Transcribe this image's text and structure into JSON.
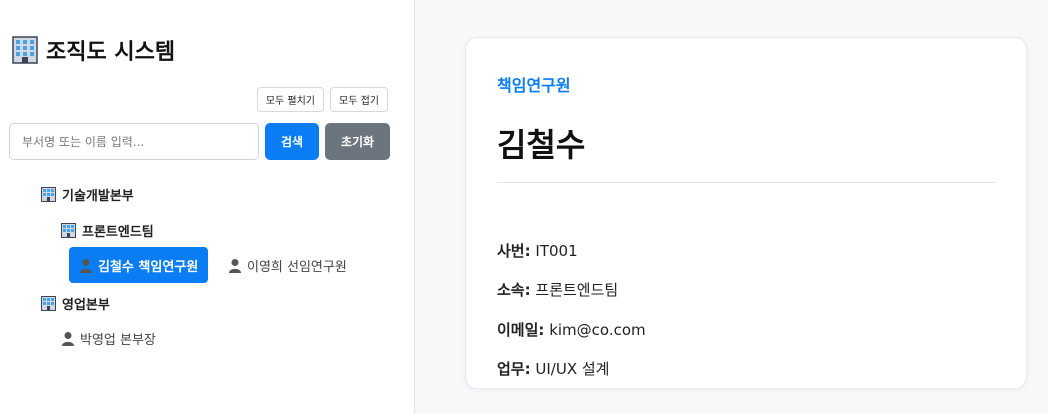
{
  "app": {
    "title": "조직도 시스템"
  },
  "toolbar": {
    "expand_all": "모두 펼치기",
    "collapse_all": "모두 접기"
  },
  "search": {
    "placeholder": "부서명 또는 이름 입력...",
    "search_label": "검색",
    "reset_label": "초기화"
  },
  "tree": {
    "dept1": {
      "label": "기술개발본부"
    },
    "team1": {
      "label": "프론트엔드팀"
    },
    "person1": {
      "label": "김철수 책임연구원"
    },
    "person2": {
      "label": "이영희 선임연구원"
    },
    "dept2": {
      "label": "영업본부"
    },
    "person3": {
      "label": "박영업 본부장"
    }
  },
  "detail": {
    "role": "책임연구원",
    "name": "김철수",
    "fields": [
      {
        "label": "사번:",
        "value": "IT001"
      },
      {
        "label": "소속:",
        "value": "프론트엔드팀"
      },
      {
        "label": "이메일:",
        "value": "kim@co.com"
      },
      {
        "label": "업무:",
        "value": "UI/UX 설계"
      }
    ]
  },
  "colors": {
    "accent": "#0a7cf4",
    "secondary": "#6c757d"
  },
  "icons": {
    "building": "office-building-icon",
    "person": "person-silhouette-icon"
  }
}
